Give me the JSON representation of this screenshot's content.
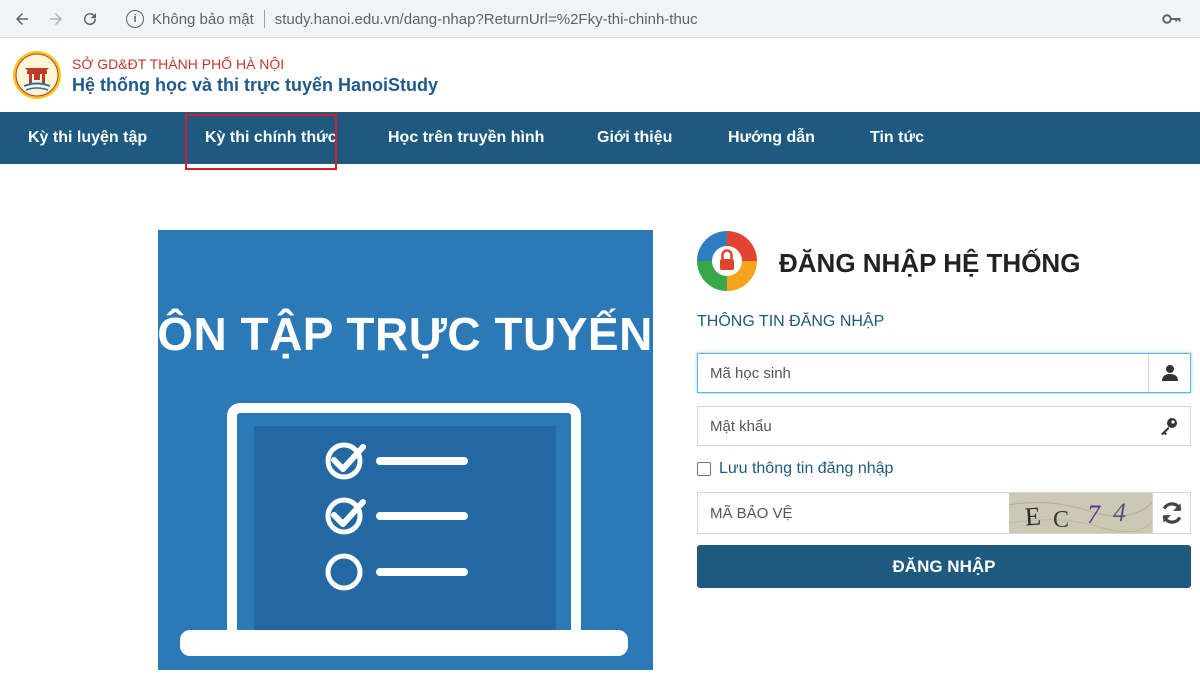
{
  "browser": {
    "security_label": "Không bảo mật",
    "url": "study.hanoi.edu.vn/dang-nhap?ReturnUrl=%2Fky-thi-chinh-thuc"
  },
  "header": {
    "org_name": "SỞ GD&ĐT THÀNH PHỐ HÀ NỘI",
    "site_name": "Hệ thống học và thi trực tuyến HanoiStudy"
  },
  "nav": {
    "items": [
      {
        "label": "Kỳ thi luyện tập"
      },
      {
        "label": "Kỳ thi chính thức"
      },
      {
        "label": "Học trên truyền hình"
      },
      {
        "label": "Giới thiệu"
      },
      {
        "label": "Hướng dẫn"
      },
      {
        "label": "Tin tức"
      }
    ],
    "highlighted_index": 1,
    "highlight_color": "#d0202c"
  },
  "banner": {
    "title": "ÔN TẬP TRỰC TUYẾN",
    "checklist_state": [
      "checked",
      "checked",
      "unchecked"
    ]
  },
  "login": {
    "title": "ĐĂNG NHẬP HỆ THỐNG",
    "section_label": "THÔNG TIN ĐĂNG NHẬP",
    "student_id_placeholder": "Mã học sinh",
    "password_placeholder": "Mật khẩu",
    "remember_label": "Lưu thông tin đăng nhập",
    "captcha_placeholder": "MÃ BẢO VỆ",
    "captcha_chars": [
      "E",
      "C",
      "7",
      "4"
    ],
    "submit_label": "ĐĂNG NHẬP",
    "icons": {
      "student_field": "user-icon",
      "password_field": "key-icon",
      "captcha_refresh": "refresh-icon"
    }
  },
  "colors": {
    "brand_blue": "#1e5a80",
    "banner_blue": "#2c79b8",
    "org_red": "#c0392b"
  }
}
